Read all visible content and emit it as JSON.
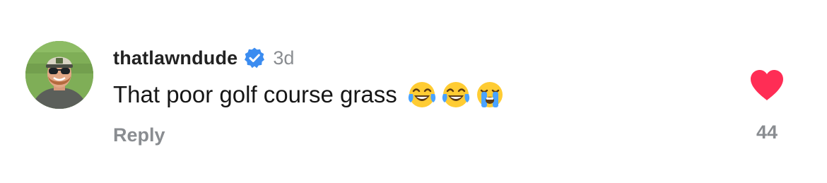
{
  "comment": {
    "username": "thatlawndude",
    "verified": true,
    "timestamp": "3d",
    "text": "That poor golf course grass",
    "emojis": [
      "face-with-tears-of-joy",
      "face-with-tears-of-joy",
      "loudly-crying-face"
    ],
    "reply_label": "Reply",
    "like_count": "44",
    "liked": true
  },
  "colors": {
    "like_heart": "#ff2d55",
    "verified_badge": "#3b8cf0",
    "muted_text": "#8a8d91",
    "username_text": "#222222"
  },
  "icons": {
    "verified": "verified-badge-icon",
    "like": "heart-icon"
  }
}
